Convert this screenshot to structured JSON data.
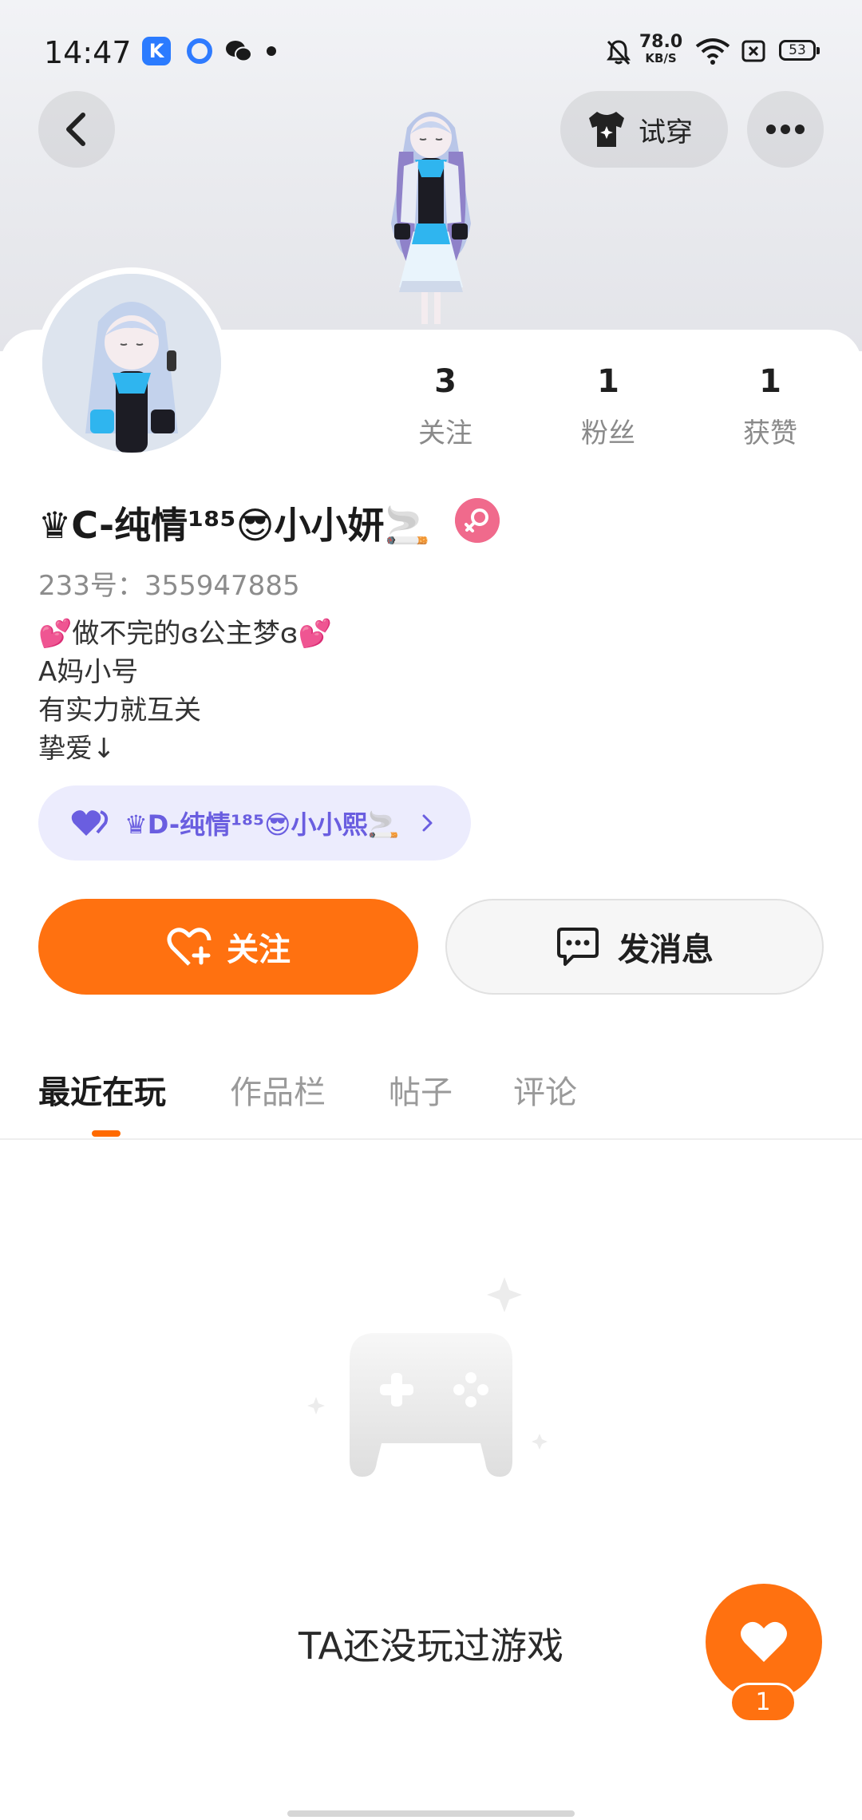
{
  "status_bar": {
    "time": "14:47",
    "app_k_label": "K",
    "net_speed_value": "78.0",
    "net_speed_unit": "KB/S",
    "battery": "53"
  },
  "header": {
    "tryon_label": "试穿"
  },
  "stats": [
    {
      "value": "3",
      "label": "关注"
    },
    {
      "value": "1",
      "label": "粉丝"
    },
    {
      "value": "1",
      "label": "获赞"
    }
  ],
  "profile": {
    "nickname": "♛C-纯情¹⁸⁵😎小小妍🚬",
    "uid": "233号：355947885",
    "bio": [
      "💕做不完的ɞ公主梦ɞ💕",
      "A妈小号",
      "有实力就互关",
      "挚爱↓"
    ],
    "linked_user": "♛D-纯情¹⁸⁵😎小小熙🚬"
  },
  "actions": {
    "follow_label": "关注",
    "message_label": "发消息"
  },
  "tabs": [
    "最近在玩",
    "作品栏",
    "帖子",
    "评论"
  ],
  "empty_state": {
    "text": "TA还没玩过游戏"
  },
  "like": {
    "count": "1"
  },
  "colors": {
    "accent": "#ff7110",
    "link_chip_bg": "#ececfd",
    "link_chip_text": "#6a5ee0",
    "gender_badge": "#f06a8c"
  }
}
